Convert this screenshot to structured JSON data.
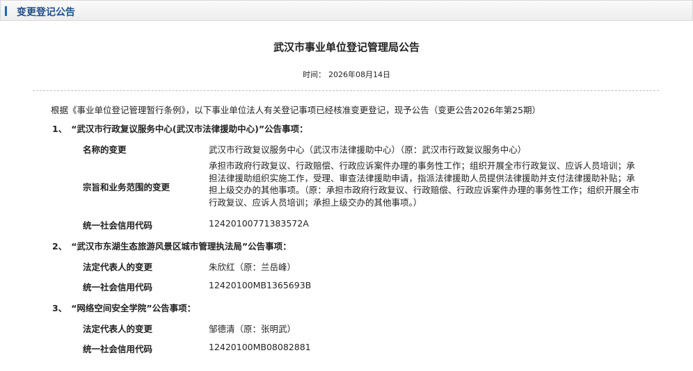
{
  "header": {
    "title": "变更登记公告"
  },
  "document": {
    "title": "武汉市事业单位登记管理局公告",
    "time_label": "时间：",
    "time_value": "2026年08月14日",
    "intro": "根据《事业单位登记管理暂行条例》，以下事业单位法人有关登记事项已经核准变更登记，现予公告（变更公告2026年第25期）"
  },
  "items": [
    {
      "number": "1、",
      "heading": "“武汉市行政复议服务中心(武汉市法律援助中心)”公告事项：",
      "fields": [
        {
          "label": "名称的变更",
          "value": "武汉市行政复议服务中心（武汉市法律援助中心）（原：武汉市行政复议服务中心）"
        },
        {
          "label": "宗旨和业务范围的变更",
          "value": "承担市政府行政复议、行政赔偿、行政应诉案件办理的事务性工作；组织开展全市行政复议、应诉人员培训；承担法律援助组织实施工作，受理、审查法律援助申请，指派法律援助人员提供法律援助并支付法律援助补贴；承担上级交办的其他事项。（原：承担市政府行政复议、行政赔偿、行政应诉案件办理的事务性工作；组织开展全市行政复议、应诉人员培训；承担上级交办的其他事项。）"
        },
        {
          "label": "统一社会信用代码",
          "value": "12420100771383572A"
        }
      ]
    },
    {
      "number": "2、",
      "heading": "“武汉市东湖生态旅游风景区城市管理执法局”公告事项：",
      "fields": [
        {
          "label": "法定代表人的变更",
          "value": "朱欣红（原：兰岳峰）"
        },
        {
          "label": "统一社会信用代码",
          "value": "12420100MB1365693B"
        }
      ]
    },
    {
      "number": "3、",
      "heading": "“网络空间安全学院”公告事项：",
      "fields": [
        {
          "label": "法定代表人的变更",
          "value": "邹德清（原：张明武）"
        },
        {
          "label": "统一社会信用代码",
          "value": "12420100MB08082881"
        }
      ]
    }
  ]
}
